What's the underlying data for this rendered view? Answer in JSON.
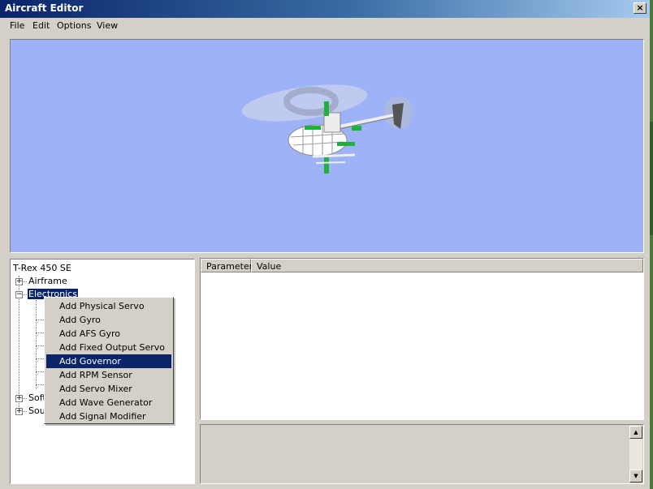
{
  "window": {
    "title": "Aircraft Editor",
    "close_glyph": "×"
  },
  "menubar": {
    "items": [
      "File",
      "Edit",
      "Options",
      "View"
    ]
  },
  "tree": {
    "root": "T-Rex 450 SE",
    "items": [
      {
        "label": "Airframe",
        "expander": "+"
      },
      {
        "label": "Electronics",
        "expander": "−"
      },
      {
        "label": "Soft",
        "expander": "+"
      },
      {
        "label": "Sou",
        "expander": "+"
      }
    ]
  },
  "grid": {
    "columns": [
      "Parameter",
      "Value"
    ]
  },
  "context_menu": {
    "items": [
      "Add Physical Servo",
      "Add Gyro",
      "Add AFS Gyro",
      "Add Fixed Output Servo",
      "Add Governor",
      "Add RPM Sensor",
      "Add Servo Mixer",
      "Add Wave Generator",
      "Add Signal Modifier"
    ],
    "highlighted_index": 4
  },
  "info_panel": {
    "scroll_up": "▲",
    "scroll_down": "▼"
  },
  "colors": {
    "viewport_bg": "#9eb2f7",
    "selection": "#0a246a",
    "face": "#d4d0c8"
  }
}
